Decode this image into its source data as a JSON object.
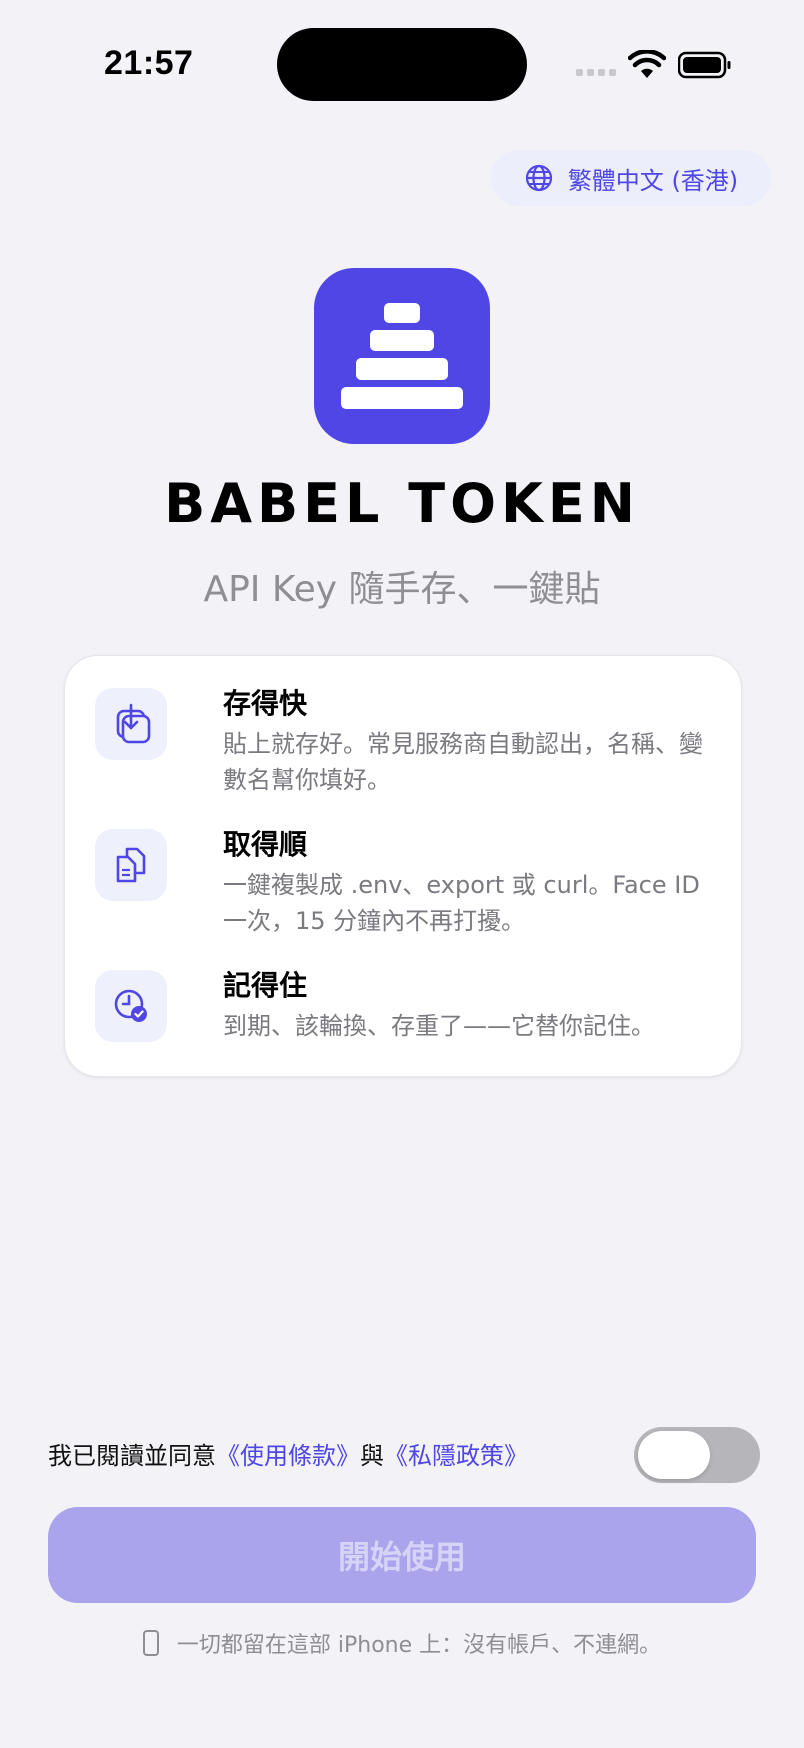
{
  "status_bar": {
    "time": "21:57"
  },
  "language": {
    "label": "繁體中文 (香港)",
    "icon": "globe-icon"
  },
  "app": {
    "name": "BABEL TOKEN",
    "tagline": "API Key 隨手存、一鍵貼",
    "brand_color": "#4f46e5"
  },
  "features": [
    {
      "icon": "download-tray-icon",
      "title": "存得快",
      "description": "貼上就存好。常見服務商自動認出，名稱、變數名幫你填好。"
    },
    {
      "icon": "copy-documents-icon",
      "title": "取得順",
      "description": "一鍵複製成 .env、export 或 curl。Face ID 一次，15 分鐘內不再打擾。"
    },
    {
      "icon": "clock-check-icon",
      "title": "記得住",
      "description": "到期、該輪換、存重了——它替你記住。"
    }
  ],
  "consent": {
    "prefix": "我已閱讀並同意",
    "terms_link": "《使用條款》",
    "conjunction": "與",
    "privacy_link": "《私隱政策》",
    "toggle_on": false
  },
  "start_button": {
    "label": "開始使用",
    "enabled": false
  },
  "footer": {
    "text": "一切都留在這部 iPhone 上：沒有帳戶、不連網。",
    "icon": "iphone-icon"
  }
}
